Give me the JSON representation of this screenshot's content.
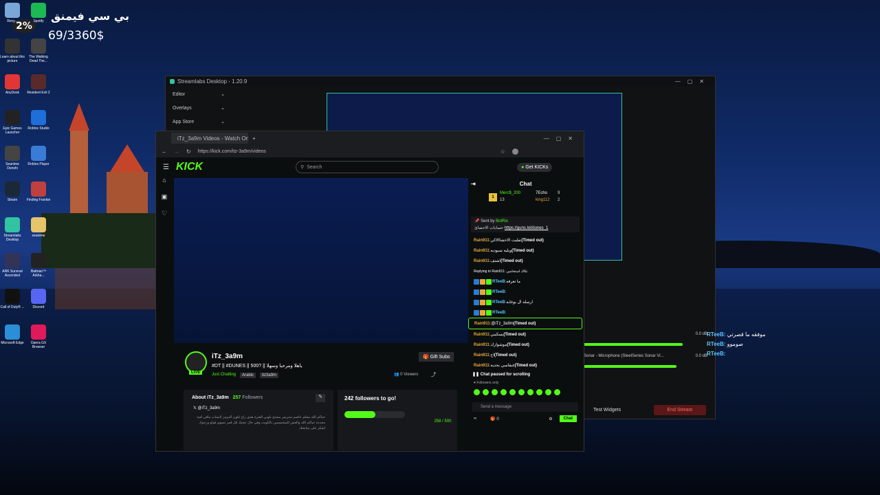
{
  "overlay": {
    "percent": "2%",
    "arabic_title": "بي سي فيمنق",
    "goal": "69/3360$"
  },
  "desktop_icons": [
    {
      "label": "Recy...",
      "color": "#7aa7d8"
    },
    {
      "label": "Spotify",
      "color": "#1db954"
    },
    {
      "label": "Learn about this picture",
      "color": "#333"
    },
    {
      "label": "The Walking Dead The...",
      "color": "#444"
    },
    {
      "label": "AnyDesk",
      "color": "#e23636"
    },
    {
      "label": "Resident Evil 2",
      "color": "#5a2a2a"
    },
    {
      "label": "Epic Games Launcher",
      "color": "#222"
    },
    {
      "label": "Roblox Studio",
      "color": "#1e6fd8"
    },
    {
      "label": "Seanime Denshi",
      "color": "#444"
    },
    {
      "label": "Roblox Player",
      "color": "#3a7bd5"
    },
    {
      "label": "Steam",
      "color": "#1b2838"
    },
    {
      "label": "Finding Frankie",
      "color": "#c04040"
    },
    {
      "label": "Streamlabs Desktop",
      "color": "#31c3a2"
    },
    {
      "label": "seanime",
      "color": "#e6c46a"
    },
    {
      "label": "ARK Survival Ascended",
      "color": "#335"
    },
    {
      "label": "Batman™ Arkha...",
      "color": "#222"
    },
    {
      "label": "Call of Duty® ...",
      "color": "#111"
    },
    {
      "label": "Discord",
      "color": "#5865f2"
    },
    {
      "label": "Microsoft Edge",
      "color": "#2a8fd6"
    },
    {
      "label": "Opera GX Browser",
      "color": "#e0195a"
    }
  ],
  "streamlabs": {
    "title": "Streamlabs Desktop - 1.20.9",
    "menu": [
      "Editor",
      "Overlays",
      "App Store"
    ],
    "mixer": [
      {
        "label": "Sonar - Microphone (SteelSeries Sonar Vi...",
        "level": "0.0 dB"
      },
      {
        "label": "",
        "level": "0.0 dB"
      }
    ],
    "test_widgets": "Test Widgets",
    "end_stream": "End Stream"
  },
  "browser": {
    "tab_title": "iTz_3a9m Videos - Watch On-De...",
    "url": "https://kick.com/itz-3a9m/videos"
  },
  "kick": {
    "logo": "KICK",
    "search_placeholder": "Search",
    "get_kicks": "Get KICKs",
    "streamer": "iTz_3a9m",
    "live": "LIVE",
    "stream_title": "#DT || #DUNES || 500? || ياهلا ومرحبا وسهلا",
    "category": "Just Chatting",
    "tags": [
      "Arabic",
      "itz3a9m"
    ],
    "viewers": "0 Viewers",
    "gift_subs": "Gift Subs",
    "about_title": "About iTz_3a9m",
    "followers_count": "257",
    "followers_label": "Followers",
    "x_handle": "@iTz_3a9m",
    "about_text": "حياكم الله معكم عاصم ستريمر مبتدئ بلوني الفترة هذي راح تكون الدونيز لاستاب مافي لعبة محددة حياكم الله والعش للمتحمسين بالكويت وفي حال عجبك قل قمر تسوي فولو ورجوك اشكر على متابعتك",
    "goal_title": "242 followers to go!",
    "goal_progress": "258 / 500",
    "goal_fraction": 0.516
  },
  "chat": {
    "title": "Chat",
    "leaders": [
      {
        "name": "Merc$_200",
        "count": "13"
      },
      {
        "name": "7Echo",
        "count": "9"
      },
      {
        "name": "king112",
        "count": "2"
      }
    ],
    "pinned_sent_by": "Sent by",
    "pinned_bot": "BotRix",
    "pinned_text": "حسابات الاحصائ",
    "pinned_link": "https://guns.lol/dunes_1",
    "messages": [
      {
        "user": "Rain911",
        "text": "تفليت الاخشاالاكي",
        "status": "(Timed out)"
      },
      {
        "user": "Rain911",
        "text": "ويليه سبوديه",
        "status": "(Timed out)"
      },
      {
        "user": "Rain911",
        "text": "اشتف",
        "status": "(Timed out)"
      },
      {
        "user": "",
        "text": "Replying to Rain911: نكاك استخامين",
        "status": ""
      },
      {
        "user": "RTeeB",
        "text": "ما تعرفه",
        "status": ""
      },
      {
        "user": "RTeeB",
        "text": "",
        "status": ""
      },
      {
        "user": "RTeeB",
        "text": "ارسله ال يوغابه",
        "status": ""
      },
      {
        "user": "RTeeB",
        "text": "",
        "status": ""
      },
      {
        "user": "Rain911",
        "text": "@iTz_3a9m",
        "status": "(Timed out)"
      },
      {
        "user": "Rain911",
        "text": "يسكيني",
        "status": "(Timed out)"
      },
      {
        "user": "Rain911",
        "text": "موشوارك",
        "status": "(Timed out)"
      },
      {
        "user": "Rain911",
        "text": "اح",
        "status": "(Timed out)"
      },
      {
        "user": "Rain911",
        "text": "غبقاسي بحديه",
        "status": "(Timed out)"
      }
    ],
    "paused": "Chat paused for scrolling",
    "followers_only": "Followers only",
    "send_placeholder": "Send a message",
    "kicks_count": "0",
    "chat_button": "Chat"
  },
  "side_chat": [
    {
      "user": "RTeeB:",
      "text": "موفقه ما قصرتي"
    },
    {
      "user": "RTeeB:",
      "text": "صوموو"
    },
    {
      "user": "RTeeB:",
      "text": ""
    }
  ]
}
